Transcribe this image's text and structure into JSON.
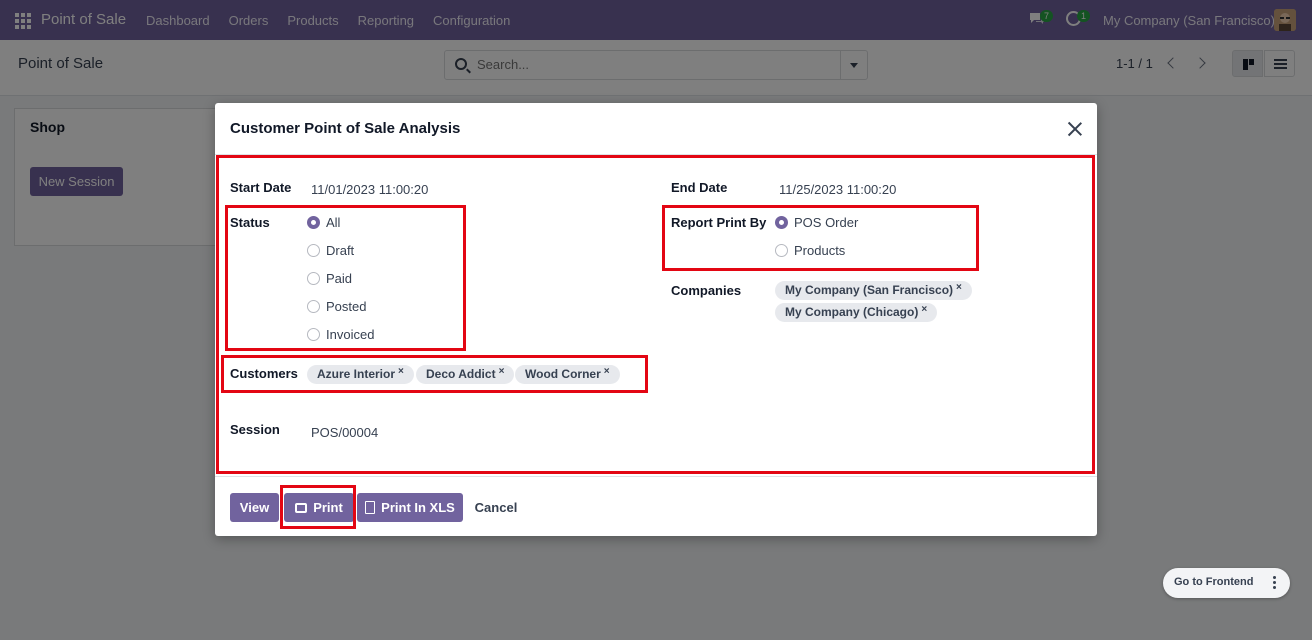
{
  "navbar": {
    "brand": "Point of Sale",
    "menu": [
      "Dashboard",
      "Orders",
      "Products",
      "Reporting",
      "Configuration"
    ],
    "chat_badge": "7",
    "activity_badge": "1",
    "company": "My Company (San Francisco)"
  },
  "control": {
    "title": "Point of Sale",
    "search_placeholder": "Search...",
    "pager": "1-1 / 1"
  },
  "kanban": {
    "shop_title": "Shop",
    "new_session_label": "New Session"
  },
  "frontend": {
    "label": "Go to Frontend"
  },
  "modal": {
    "title": "Customer Point of Sale Analysis",
    "start_date_label": "Start Date",
    "start_date_value": "11/01/2023 11:00:20",
    "end_date_label": "End Date",
    "end_date_value": "11/25/2023 11:00:20",
    "status_label": "Status",
    "status_options": [
      "All",
      "Draft",
      "Paid",
      "Posted",
      "Invoiced"
    ],
    "status_selected": "All",
    "report_print_by_label": "Report Print By",
    "report_options": [
      "POS Order",
      "Products"
    ],
    "report_selected": "POS Order",
    "companies_label": "Companies",
    "companies": [
      "My Company (San Francisco)",
      "My Company (Chicago)"
    ],
    "customers_label": "Customers",
    "customers": [
      "Azure Interior",
      "Deco Addict",
      "Wood Corner"
    ],
    "session_label": "Session",
    "session_value": "POS/00004",
    "buttons": {
      "view": "View",
      "print": "Print",
      "print_xls": "Print In XLS",
      "cancel": "Cancel"
    },
    "tag_remove": "×"
  },
  "colors": {
    "brand": "#71639e",
    "highlight": "#e30613",
    "badge": "#28a745"
  }
}
